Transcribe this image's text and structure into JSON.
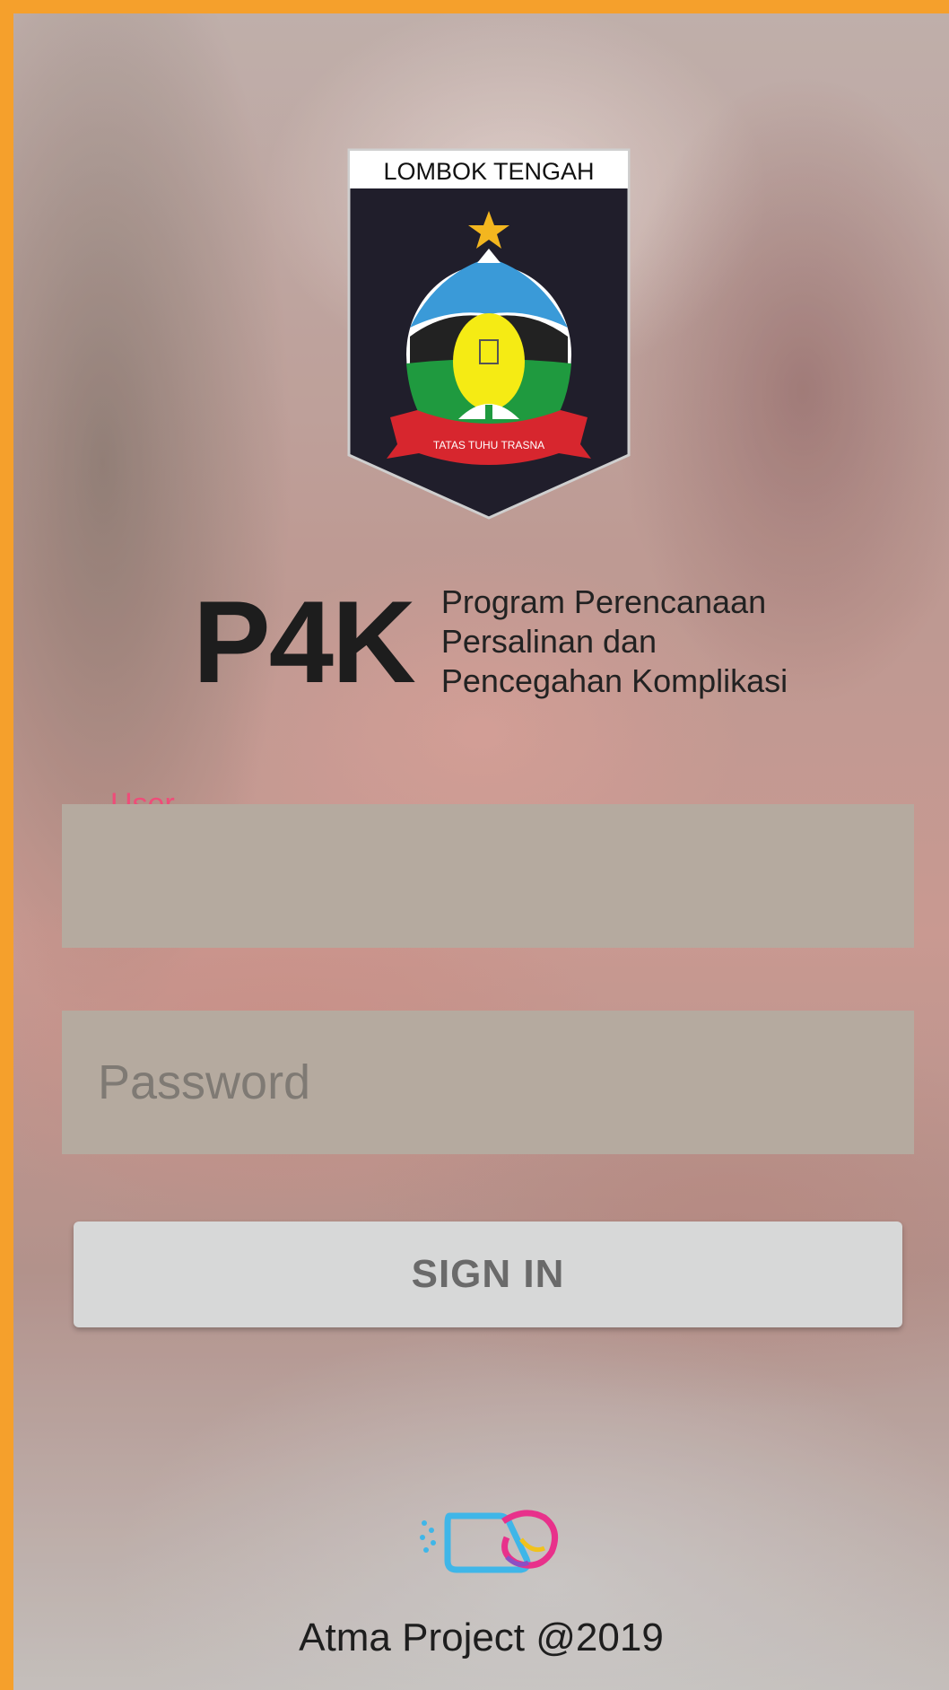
{
  "header": {
    "emblem_text": "LOMBOK TENGAH",
    "emblem_motto": "TATAS TUHU TRASNA"
  },
  "brand": {
    "title": "P4K",
    "subtitle_lines": [
      "Program Perencanaan",
      "Persalinan dan",
      "Pencegahan Komplikasi"
    ]
  },
  "form": {
    "user_label": "User",
    "user_value": "",
    "password_placeholder": "Password",
    "sign_in_label": "SIGN IN"
  },
  "footer": {
    "text": "Atma Project @2019"
  },
  "colors": {
    "frame": "#f5a02c",
    "field": "#b5aa9f",
    "label_accent": "#ee4d79",
    "button": "#d7d8d8"
  }
}
